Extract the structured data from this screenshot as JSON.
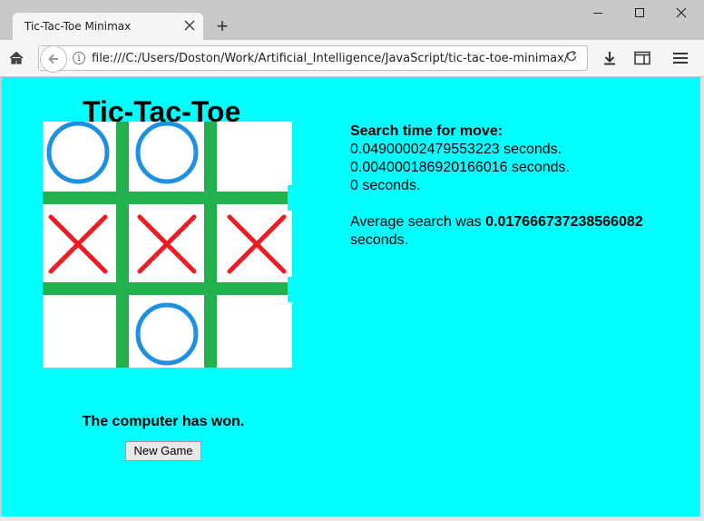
{
  "browser": {
    "tab_title": "Tic-Tac-Toe Minimax",
    "tab_close_icon": "close-icon",
    "new_tab_symbol": "+",
    "url": "file:///C:/Users/Doston/Work/Artificial_Intelligence/JavaScript/tic-tac-toe-minimax/",
    "window_controls": [
      "minimize",
      "maximize",
      "close"
    ]
  },
  "page": {
    "title": "Tic-Tac-Toe",
    "board": [
      [
        "O",
        "O",
        ""
      ],
      [
        "X",
        "X",
        "X"
      ],
      [
        "",
        "O",
        ""
      ]
    ],
    "status": "The computer has won.",
    "new_game_label": "New Game",
    "search_heading": "Search time for move:",
    "search_times": [
      "0.04900002479553223 seconds.",
      "0.004000186920166016 seconds.",
      "0 seconds."
    ],
    "average_prefix": "Average search was ",
    "average_value": "0.017666737238566082",
    "average_suffix": "seconds."
  },
  "colors": {
    "background": "#00ffff",
    "grid": "#22b14c",
    "o_mark": "#1e90e0",
    "x_mark": "#ed1c24"
  }
}
